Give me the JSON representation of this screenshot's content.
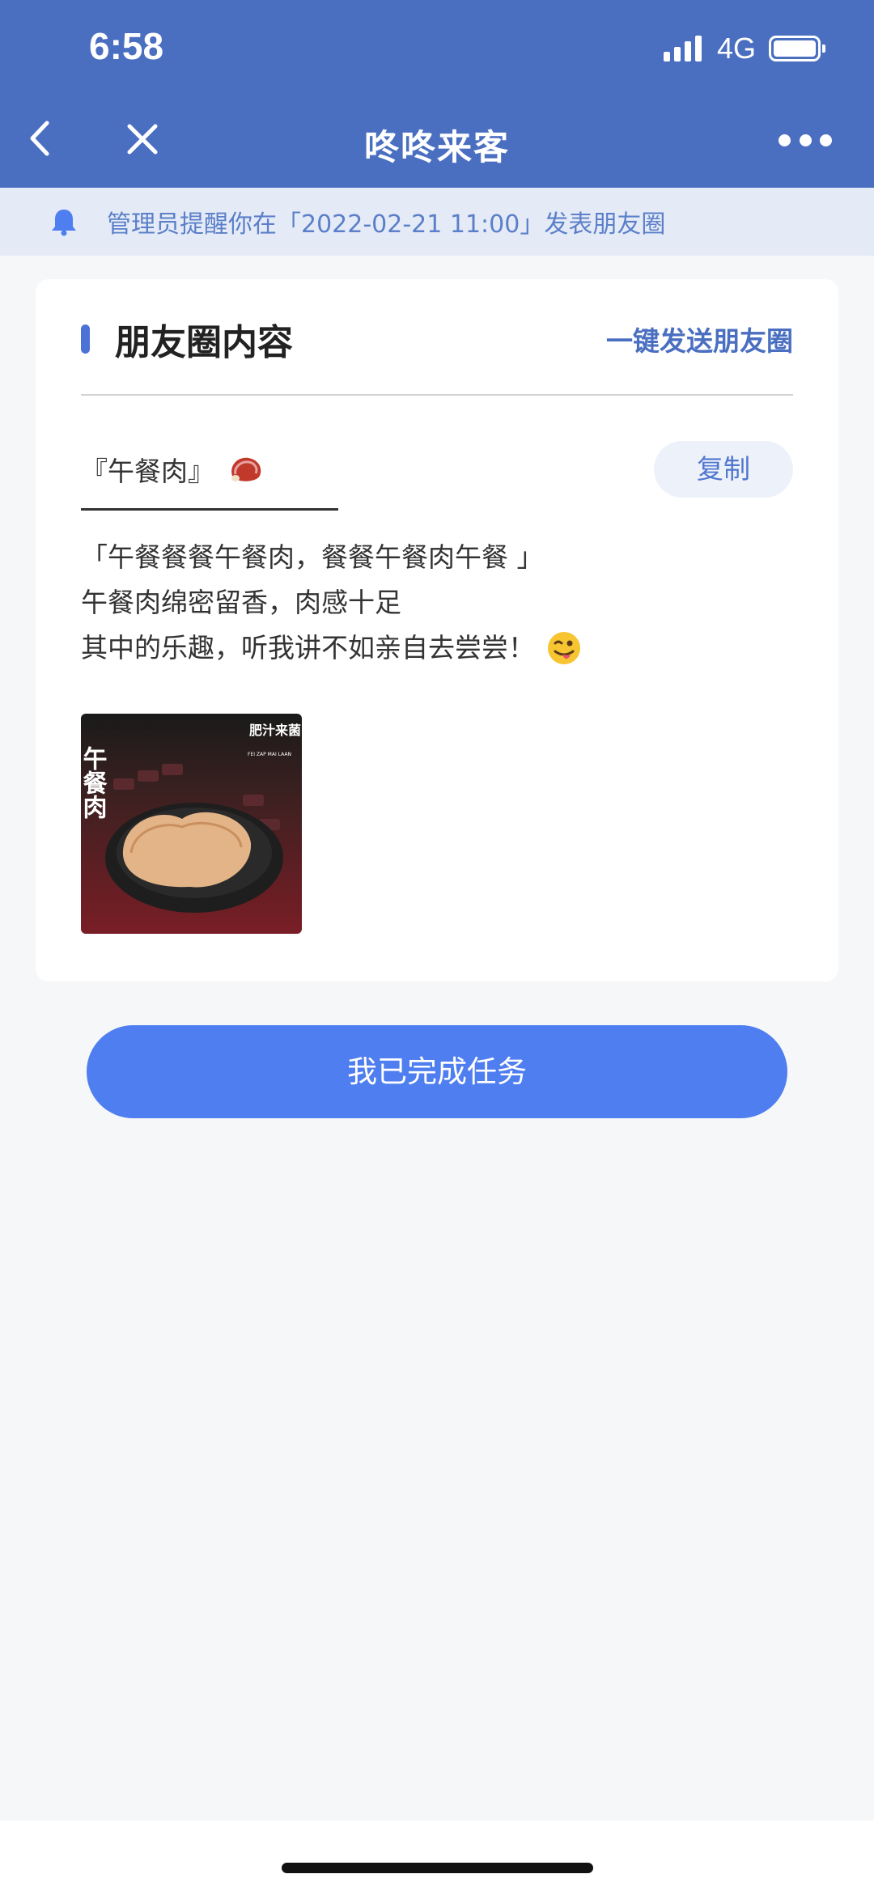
{
  "status_bar": {
    "time": "6:58",
    "network": "4G"
  },
  "nav": {
    "title": "咚咚来客",
    "back_icon": "chevron-left-icon",
    "close_icon": "close-icon",
    "more_icon": "more-dots-icon"
  },
  "notice": {
    "icon": "bell-icon",
    "text": "管理员提醒你在「2022-02-21 11:00」发表朋友圈"
  },
  "card": {
    "title": "朋友圈内容",
    "send_link": "一键发送朋友圈",
    "post_title": "『午餐肉』",
    "post_title_emoji": "meat-emoji",
    "copy_label": "复制",
    "body_lines": [
      "「午餐餐餐午餐肉，餐餐午餐肉午餐 」",
      "午餐肉绵密留香，肉感十足",
      "其中的乐趣，听我讲不如亲自去尝尝！"
    ],
    "body_emoji": "winking-tongue-emoji",
    "image": {
      "title_text": "午餐肉",
      "brand_text": "肥汁来菌",
      "brand_sub": "FEI ZAP MAI LAAN"
    }
  },
  "done_button": "我已完成任务",
  "colors": {
    "header": "#4a6fc1",
    "accent": "#4f7ef0",
    "notice_bg": "#e5ebf6"
  }
}
